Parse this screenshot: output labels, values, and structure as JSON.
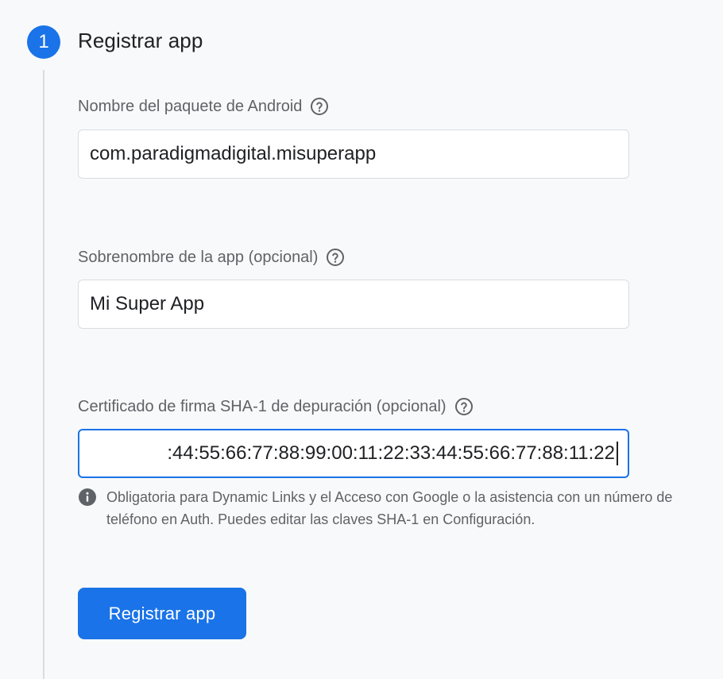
{
  "step": {
    "number": "1",
    "title": "Registrar app"
  },
  "fields": {
    "package_name": {
      "label": "Nombre del paquete de Android",
      "value": "com.paradigmadigital.misuperapp",
      "help_icon": "help-circle-icon"
    },
    "nickname": {
      "label": "Sobrenombre de la app (opcional)",
      "value": "Mi Super App",
      "help_icon": "help-circle-icon"
    },
    "sha1": {
      "label": "Certificado de firma SHA-1 de depuración (opcional)",
      "value": ":44:55:66:77:88:99:00:11:22:33:44:55:66:77:88:11:22",
      "help_icon": "help-circle-icon"
    }
  },
  "hint": {
    "icon": "info-icon",
    "text": "Obligatoria para Dynamic Links y el Acceso con Google o la asistencia con un número de teléfono en Auth. Puedes editar las claves SHA-1 en Configuración."
  },
  "actions": {
    "register_label": "Registrar app"
  },
  "colors": {
    "accent": "#1a73e8",
    "background": "#f8f9fa",
    "label": "#5f6368",
    "text": "#202124",
    "border": "#dadce0"
  }
}
